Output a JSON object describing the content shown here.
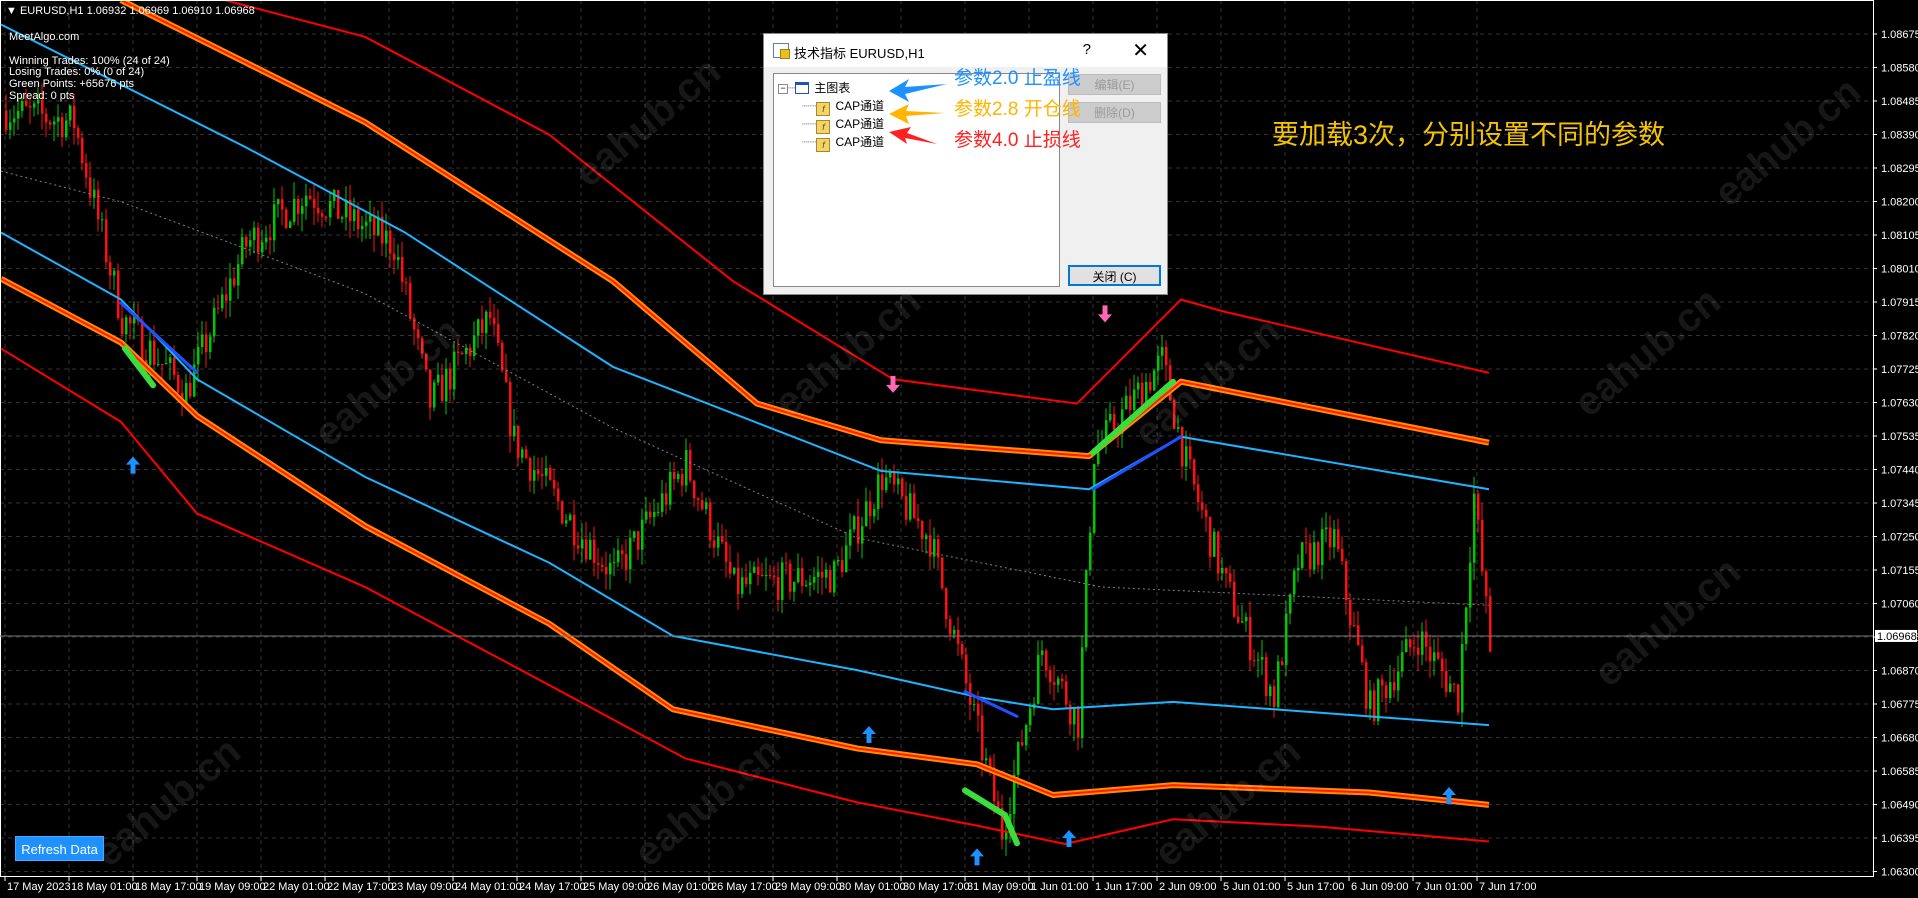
{
  "header": {
    "symbol_line": "EURUSD,H1  1.06932 1.06969 1.06910 1.06968"
  },
  "info": {
    "brand": "MeetAlgo.com",
    "winning": "Winning Trades: 100% (24 of 24)",
    "losing": "Losing Trades: 0% (0 of 24)",
    "points": "Green Points: +65676 pts",
    "spread": "Spread: 0 pts"
  },
  "refresh_button": "Refresh Data",
  "watermark": "eahub.cn",
  "annotation_main": "要加载3次，分别设置不同的参数",
  "dialog": {
    "title": "技术指标 EURUSD,H1",
    "help": "?",
    "close_x": "✕",
    "root": "主图表",
    "items": [
      "CAP通道",
      "CAP通道",
      "CAP通道"
    ],
    "edit": "编辑(E)",
    "delete": "删除(D)",
    "close": "关闭 (C)",
    "notes": [
      {
        "text": "参数2.0 止盈线",
        "color": "#1e90ff"
      },
      {
        "text": "参数2.8 开仓线",
        "color": "#ffb400"
      },
      {
        "text": "参数4.0 止损线",
        "color": "#ff2020"
      }
    ]
  },
  "colors": {
    "bull": "#00c800",
    "bear": "#ff1010",
    "red_band": "#ff0000",
    "orange_band": "#ff8c00",
    "cyan_band": "#1eb4ff",
    "mid": "#808080",
    "up_arrow": "#1e90ff",
    "down_arrow": "#ff69b4"
  },
  "chart_data": {
    "type": "candlestick",
    "symbol": "EURUSD",
    "timeframe": "H1",
    "current_price": "1.06968",
    "price_ticks": [
      "1.08675",
      "1.08580",
      "1.08485",
      "1.08390",
      "1.08295",
      "1.08200",
      "1.08105",
      "1.08010",
      "1.07915",
      "1.07820",
      "1.07725",
      "1.07630",
      "1.07535",
      "1.07440",
      "1.07345",
      "1.07250",
      "1.07155",
      "1.07060",
      "1.06965",
      "1.06870",
      "1.06775",
      "1.06680",
      "1.06585",
      "1.06490",
      "1.06395",
      "1.06300"
    ],
    "time_ticks": [
      "17 May 2023",
      "18 May 01:00",
      "18 May 17:00",
      "19 May 09:00",
      "22 May 01:00",
      "22 May 17:00",
      "23 May 09:00",
      "24 May 01:00",
      "24 May 17:00",
      "25 May 09:00",
      "26 May 01:00",
      "26 May 17:00",
      "29 May 09:00",
      "30 May 01:00",
      "30 May 17:00",
      "31 May 09:00",
      "1 Jun 01:00",
      "1 Jun 17:00",
      "2 Jun 09:00",
      "5 Jun 01:00",
      "5 Jun 17:00",
      "6 Jun 09:00",
      "7 Jun 01:00",
      "7 Jun 17:00"
    ],
    "bars_per_tick": 16,
    "ylim": [
      1.063,
      1.08675
    ],
    "close_path": [
      [
        -1,
        1.0846
      ],
      [
        17,
        1.08425
      ],
      [
        29,
        1.0787
      ],
      [
        45,
        1.07662
      ],
      [
        60,
        1.08078
      ],
      [
        75,
        1.08225
      ],
      [
        97,
        1.08078
      ],
      [
        106,
        1.07627
      ],
      [
        121,
        1.0787
      ],
      [
        127,
        1.07523
      ],
      [
        142,
        1.0728
      ],
      [
        152,
        1.07142
      ],
      [
        170,
        1.07454
      ],
      [
        182,
        1.07107
      ],
      [
        207,
        1.07142
      ],
      [
        219,
        1.07419
      ],
      [
        231,
        1.07246
      ],
      [
        240,
        1.06829
      ],
      [
        249,
        1.06413
      ],
      [
        259,
        1.06933
      ],
      [
        268,
        1.06725
      ],
      [
        272,
        1.07488
      ],
      [
        289,
        1.07748
      ],
      [
        295,
        1.07454
      ],
      [
        305,
        1.07107
      ],
      [
        317,
        1.06795
      ],
      [
        323,
        1.07176
      ],
      [
        332,
        1.07246
      ],
      [
        341,
        1.0676
      ],
      [
        353,
        1.06968
      ],
      [
        363,
        1.06795
      ],
      [
        367,
        1.07367
      ],
      [
        371,
        1.06933
      ]
    ],
    "bands": [
      {
        "name": "outer-upper",
        "color": "red_band",
        "width": 2,
        "points": [
          [
            55,
            1.08771
          ],
          [
            90,
            1.08667
          ],
          [
            136,
            1.0839
          ],
          [
            182,
            1.07974
          ],
          [
            222,
            1.07696
          ],
          [
            268,
            1.07627
          ],
          [
            294,
            1.07922
          ],
          [
            305,
            1.07887
          ],
          [
            371,
            1.07714
          ]
        ]
      },
      {
        "name": "entry-upper",
        "color": "orange_band",
        "width": 5,
        "points": [
          [
            29,
            1.08771
          ],
          [
            90,
            1.08425
          ],
          [
            152,
            1.07974
          ],
          [
            188,
            1.07627
          ],
          [
            219,
            1.07523
          ],
          [
            271,
            1.07478
          ],
          [
            294,
            1.07689
          ],
          [
            371,
            1.07516
          ]
        ]
      },
      {
        "name": "tp-upper",
        "color": "cyan_band",
        "width": 2,
        "points": [
          [
            -1,
            1.08702
          ],
          [
            60,
            1.08355
          ],
          [
            100,
            1.08112
          ],
          [
            152,
            1.07731
          ],
          [
            219,
            1.07436
          ],
          [
            271,
            1.07384
          ],
          [
            294,
            1.07533
          ],
          [
            371,
            1.07384
          ]
        ]
      },
      {
        "name": "middle",
        "color": "mid",
        "width": 1,
        "dashed": true,
        "points": [
          [
            -1,
            1.08286
          ],
          [
            29,
            1.08199
          ],
          [
            90,
            1.07939
          ],
          [
            152,
            1.07558
          ],
          [
            213,
            1.07246
          ],
          [
            274,
            1.07107
          ],
          [
            371,
            1.07055
          ]
        ]
      },
      {
        "name": "tp-lower",
        "color": "cyan_band",
        "width": 2,
        "points": [
          [
            -1,
            1.08112
          ],
          [
            29,
            1.07922
          ],
          [
            48,
            1.07696
          ],
          [
            90,
            1.07419
          ],
          [
            136,
            1.07176
          ],
          [
            167,
            1.06968
          ],
          [
            213,
            1.06871
          ],
          [
            243,
            1.06795
          ],
          [
            262,
            1.0676
          ],
          [
            292,
            1.06781
          ],
          [
            371,
            1.06715
          ]
        ]
      },
      {
        "name": "entry-lower",
        "color": "orange_band",
        "width": 5,
        "points": [
          [
            -1,
            1.07981
          ],
          [
            29,
            1.078
          ],
          [
            48,
            1.07592
          ],
          [
            90,
            1.0728
          ],
          [
            136,
            1.07003
          ],
          [
            167,
            1.0676
          ],
          [
            213,
            1.06649
          ],
          [
            243,
            1.06604
          ],
          [
            262,
            1.06517
          ],
          [
            292,
            1.06545
          ],
          [
            341,
            1.06524
          ],
          [
            371,
            1.06489
          ]
        ]
      },
      {
        "name": "sl-lower",
        "color": "red_band",
        "width": 2,
        "points": [
          [
            -1,
            1.07783
          ],
          [
            29,
            1.07575
          ],
          [
            48,
            1.07315
          ],
          [
            90,
            1.07107
          ],
          [
            136,
            1.06829
          ],
          [
            170,
            1.06621
          ],
          [
            213,
            1.06496
          ],
          [
            243,
            1.0643
          ],
          [
            265,
            1.06378
          ],
          [
            292,
            1.06448
          ],
          [
            329,
            1.06427
          ],
          [
            371,
            1.06385
          ]
        ]
      }
    ],
    "highlights": [
      {
        "color": "#3cdc3c",
        "points": [
          [
            30,
            1.07783
          ],
          [
            37,
            1.07679
          ]
        ]
      },
      {
        "color": "#3cdc3c",
        "points": [
          [
            240,
            1.0653
          ],
          [
            250,
            1.0646
          ],
          [
            253,
            1.0638
          ]
        ]
      },
      {
        "color": "#3cdc3c",
        "points": [
          [
            272,
            1.07488
          ],
          [
            292,
            1.07689
          ]
        ]
      },
      {
        "color": "#2050ff",
        "points": [
          [
            29,
            1.07912
          ],
          [
            48,
            1.07715
          ]
        ]
      },
      {
        "color": "#2050ff",
        "points": [
          [
            240,
            1.0681
          ],
          [
            253,
            1.0674
          ]
        ]
      },
      {
        "color": "#2050ff",
        "points": [
          [
            272,
            1.07384
          ],
          [
            294,
            1.07533
          ]
        ]
      }
    ],
    "up_arrows": [
      [
        32,
        1.07454
      ],
      [
        216,
        1.0669
      ],
      [
        243,
        1.06343
      ]
    ],
    "up_arrows_b": [
      [
        266,
        1.06395
      ],
      [
        361,
        1.06517
      ]
    ],
    "down_arrows": [
      [
        222,
        1.0768
      ],
      [
        275,
        1.0788
      ]
    ]
  }
}
